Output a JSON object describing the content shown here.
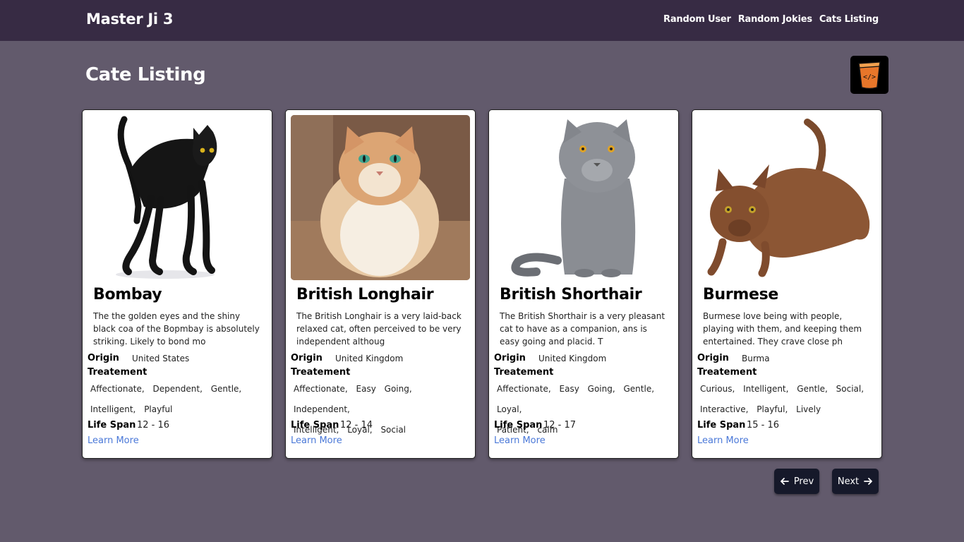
{
  "header": {
    "brand": "Master Ji 3",
    "nav": [
      "Random User",
      "Random Jokies",
      "Cats Listing"
    ]
  },
  "page": {
    "title": "Cate Listing"
  },
  "labels": {
    "origin": "Origin",
    "treatement": "Treatement",
    "life_span": "Life Span",
    "learn_more": "Learn More"
  },
  "cats": [
    {
      "name": "Bombay",
      "description": "The the golden eyes and the shiny black coa of the Bopmbay is absolutely striking. Likely to bond mo",
      "origin": "United States",
      "temperament": [
        "Affectionate,",
        "Dependent,",
        "Gentle,",
        "Intelligent,",
        "Playful"
      ],
      "life_span": "12 - 16"
    },
    {
      "name": "British Longhair",
      "description": "The British Longhair is a very laid-back relaxed cat, often perceived to be very independent althoug",
      "origin": "United Kingdom",
      "temperament": [
        "Affectionate,",
        "Easy",
        "Going,",
        "Independent,",
        "Intelligent,",
        "Loyal,",
        "Social"
      ],
      "life_span": "12 - 14"
    },
    {
      "name": "British Shorthair",
      "description": "The British Shorthair is a very pleasant cat to have as a companion, ans is easy going and placid. T",
      "origin": "United Kingdom",
      "temperament": [
        "Affectionate,",
        "Easy",
        "Going,",
        "Gentle,",
        "Loyal,",
        "Patient,",
        "calm"
      ],
      "life_span": "12 - 17"
    },
    {
      "name": "Burmese",
      "description": "Burmese love being with people, playing with them, and keeping them entertained. They crave close ph",
      "origin": "Burma",
      "temperament": [
        "Curious,",
        "Intelligent,",
        "Gentle,",
        "Social,",
        "Interactive,",
        "Playful,",
        "Lively"
      ],
      "life_span": "15 - 16"
    }
  ],
  "pagination": {
    "prev": "Prev",
    "next": "Next"
  },
  "colors": {
    "background": "#625a6c",
    "navbar": "#372b44",
    "card": "#ffffff",
    "link": "#4a78d8",
    "button": "#16192a"
  }
}
